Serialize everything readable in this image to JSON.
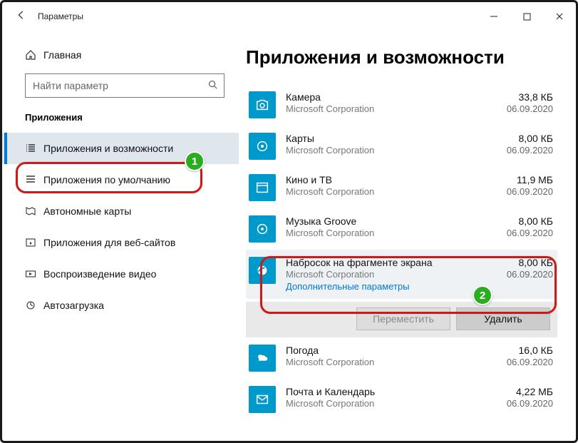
{
  "window": {
    "title": "Параметры"
  },
  "sidebar": {
    "home": "Главная",
    "search_placeholder": "Найти параметр",
    "section": "Приложения",
    "items": [
      {
        "label": "Приложения и возможности"
      },
      {
        "label": "Приложения по умолчанию"
      },
      {
        "label": "Автономные карты"
      },
      {
        "label": "Приложения для веб-сайтов"
      },
      {
        "label": "Воспроизведение видео"
      },
      {
        "label": "Автозагрузка"
      }
    ]
  },
  "main": {
    "heading": "Приложения и возможности",
    "corp": "Microsoft Corporation",
    "advanced": "Дополнительные параметры",
    "move": "Переместить",
    "remove": "Удалить",
    "apps": [
      {
        "name": "Камера",
        "size": "33,8 КБ",
        "date": "06.09.2020"
      },
      {
        "name": "Карты",
        "size": "8,00 КБ",
        "date": "06.09.2020"
      },
      {
        "name": "Кино и ТВ",
        "size": "11,9 МБ",
        "date": "06.09.2020"
      },
      {
        "name": "Музыка Groove",
        "size": "8,00 КБ",
        "date": "06.09.2020"
      },
      {
        "name": "Набросок на фрагменте экрана",
        "size": "8,00 КБ",
        "date": "06.09.2020"
      },
      {
        "name": "Погода",
        "size": "16,0 КБ",
        "date": "06.09.2020"
      },
      {
        "name": "Почта и Календарь",
        "size": "4,22 МБ",
        "date": "06.09.2020"
      }
    ]
  },
  "annotations": {
    "b1": "1",
    "b2": "2"
  }
}
